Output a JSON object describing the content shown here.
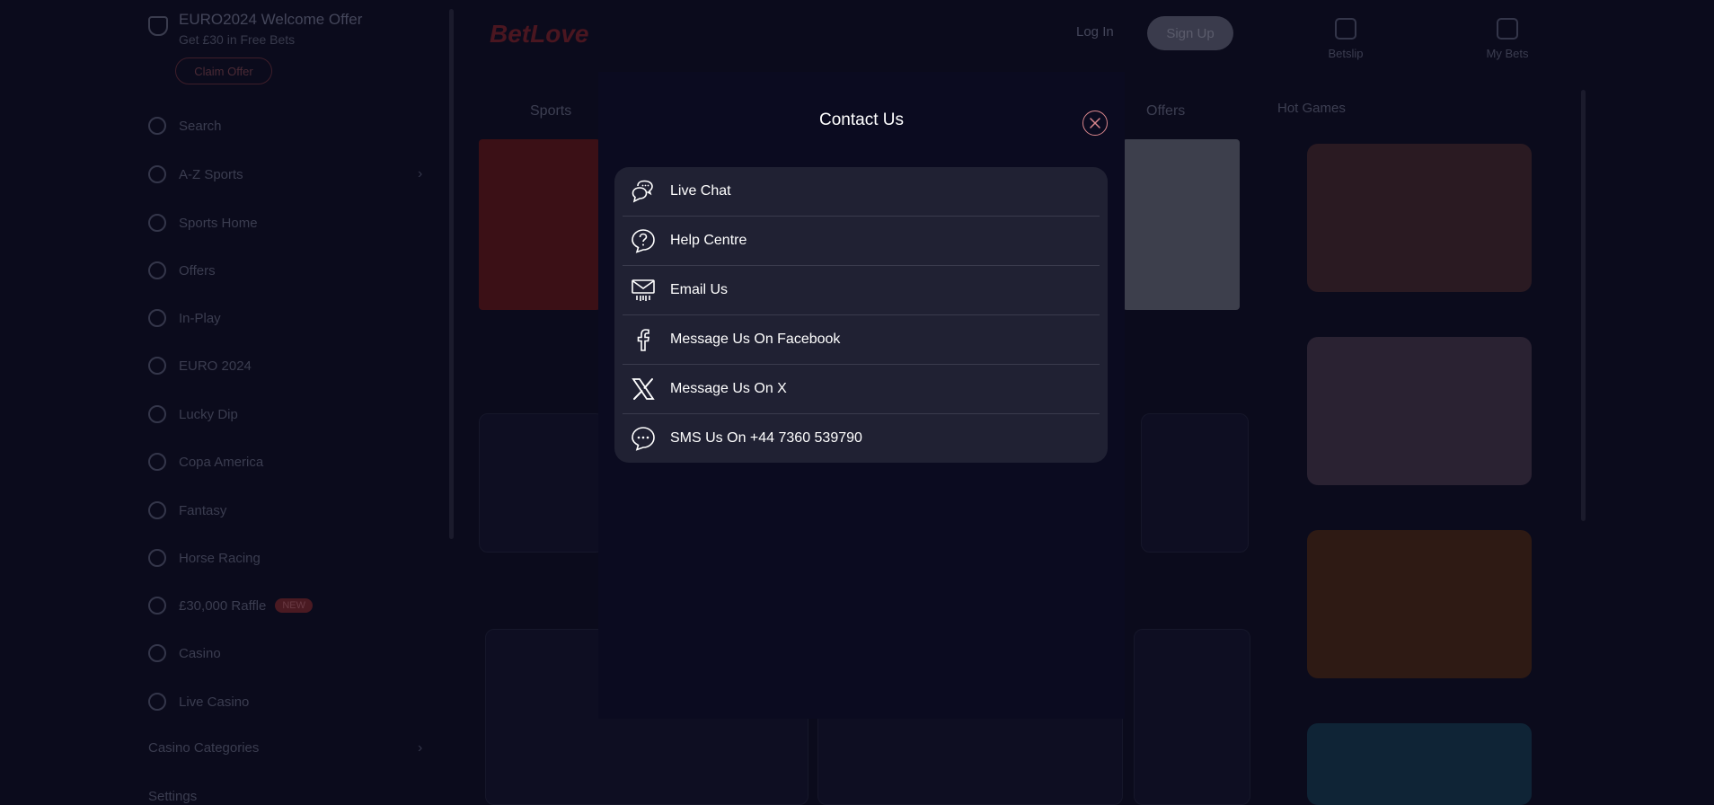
{
  "background": {
    "promo": {
      "title": "EURO2024 Welcome Offer",
      "subtitle": "Get £30 in Free Bets",
      "claim_label": "Claim Offer"
    },
    "nav": [
      {
        "label": "Search"
      },
      {
        "label": "A-Z Sports"
      },
      {
        "label": "Sports Home"
      },
      {
        "label": "Offers"
      },
      {
        "label": "In-Play"
      },
      {
        "label": "EURO 2024"
      },
      {
        "label": "Lucky Dip"
      },
      {
        "label": "Copa America"
      },
      {
        "label": "Fantasy"
      },
      {
        "label": "Horse Racing"
      },
      {
        "label": "£30,000 Raffle",
        "badge": "NEW"
      },
      {
        "label": "Casino"
      },
      {
        "label": "Live Casino"
      },
      {
        "label": "Casino Categories"
      },
      {
        "label": "Settings"
      }
    ],
    "logo": "BetLove",
    "login_label": "Log In",
    "signup_label": "Sign Up",
    "top_icons": [
      {
        "label": "Betslip"
      },
      {
        "label": "My Bets"
      }
    ],
    "tabs": [
      "Sports",
      "Offers"
    ],
    "right_panel_title": "Hot Games"
  },
  "modal": {
    "title": "Contact Us",
    "items": [
      {
        "label": "Live Chat",
        "icon": "live-chat-icon"
      },
      {
        "label": "Help Centre",
        "icon": "help-icon"
      },
      {
        "label": "Email Us",
        "icon": "email-icon"
      },
      {
        "label": "Message Us On Facebook",
        "icon": "facebook-icon"
      },
      {
        "label": "Message Us On X",
        "icon": "x-icon"
      },
      {
        "label": "SMS Us On +44 7360 539790",
        "icon": "sms-icon"
      }
    ]
  },
  "colors": {
    "modal_bg": "#0b0b20",
    "list_bg": "#202133",
    "close_accent": "#d9868c",
    "page_bg": "#0b0b1c"
  }
}
